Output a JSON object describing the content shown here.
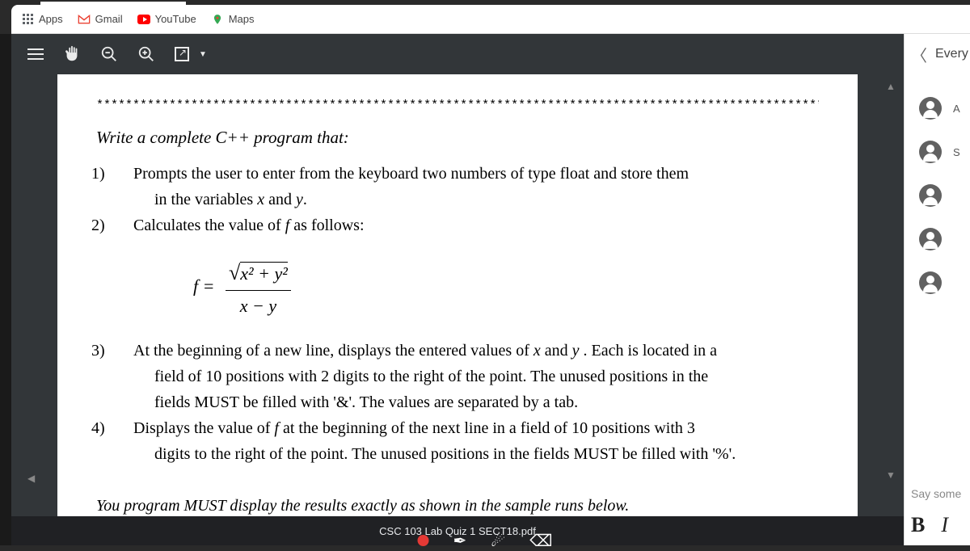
{
  "bookmarks": {
    "apps": "Apps",
    "gmail": "Gmail",
    "youtube": "YouTube",
    "maps": "Maps"
  },
  "pdf": {
    "filename": "CSC 103 Lab Quiz 1 SECT18.pdf",
    "stars": "*****************************************************************************************************",
    "title": "Write a complete C++ program that:",
    "item1_a": "Prompts the user to enter from the keyboard two numbers of type float and store them",
    "item1_b": "in the variables ",
    "item1_c": " and ",
    "item1_d": ".",
    "var_x": "x",
    "var_y": "y",
    "var_f": "f",
    "item2": "Calculates the value of ",
    "item2_b": " as follows:",
    "formula_lhs": "f =",
    "formula_num": "x² + y²",
    "formula_den": "x − y",
    "item3_a": "At the beginning of a new line, displays the entered values of ",
    "item3_b": " and ",
    "item3_c": " . Each is located in a",
    "item3_d": "field of 10 positions with 2 digits to the right of the point. The unused positions in the",
    "item3_e": "fields MUST be filled with '&'. The values are separated by a tab.",
    "item4_a": "Displays the value of ",
    "item4_b": " at the beginning of the next line in a field of 10 positions with 3",
    "item4_c": "digits to the right of the point. The unused positions in the fields MUST be filled with '%'.",
    "footer": "You program MUST display the results exactly as shown in the sample runs below."
  },
  "right": {
    "header": "Every",
    "labels": [
      "A",
      "S",
      "",
      "",
      ""
    ],
    "say": "Say some",
    "bold": "B",
    "italic": "I"
  }
}
